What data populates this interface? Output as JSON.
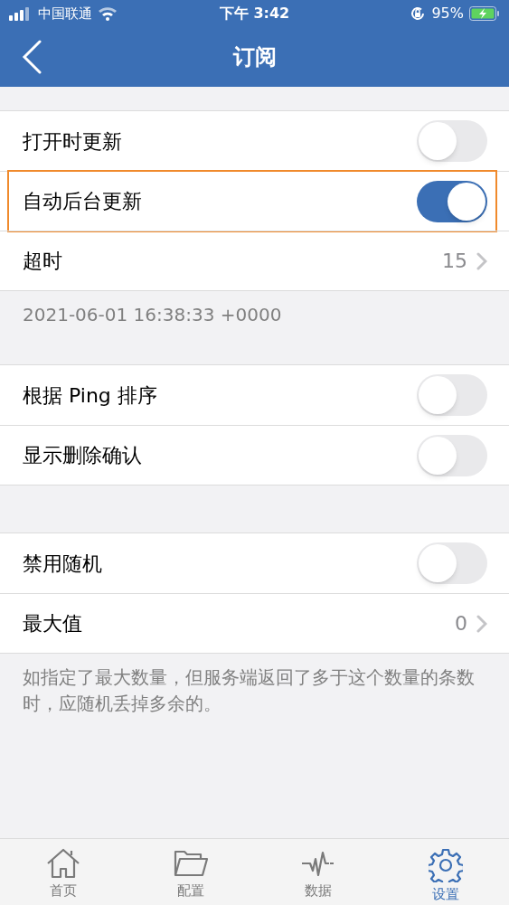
{
  "status_bar": {
    "carrier": "中国联通",
    "time": "下午 3:42",
    "battery": "95%"
  },
  "nav_bar": {
    "title": "订阅"
  },
  "sections": [
    {
      "rows": [
        {
          "kind": "toggle",
          "label": "打开时更新",
          "on": false,
          "highlighted": false
        },
        {
          "kind": "toggle",
          "label": "自动后台更新",
          "on": true,
          "highlighted": true
        },
        {
          "kind": "value",
          "label": "超时",
          "value": "15",
          "highlighted": false
        }
      ],
      "footer": "2021-06-01 16:38:33 +0000"
    },
    {
      "rows": [
        {
          "kind": "toggle",
          "label": "根据 Ping 排序",
          "on": false,
          "highlighted": false
        },
        {
          "kind": "toggle",
          "label": "显示删除确认",
          "on": false,
          "highlighted": false
        }
      ]
    },
    {
      "rows": [
        {
          "kind": "toggle",
          "label": "禁用随机",
          "on": false,
          "highlighted": false
        },
        {
          "kind": "value",
          "label": "最大值",
          "value": "0",
          "highlighted": false
        }
      ],
      "footer": "如指定了最大数量，但服务端返回了多于这个数量的条数时，应随机丢掉多余的。"
    }
  ],
  "tab_bar": [
    {
      "label": "首页",
      "selected": false
    },
    {
      "label": "配置",
      "selected": false
    },
    {
      "label": "数据",
      "selected": false
    },
    {
      "label": "设置",
      "selected": true
    }
  ]
}
